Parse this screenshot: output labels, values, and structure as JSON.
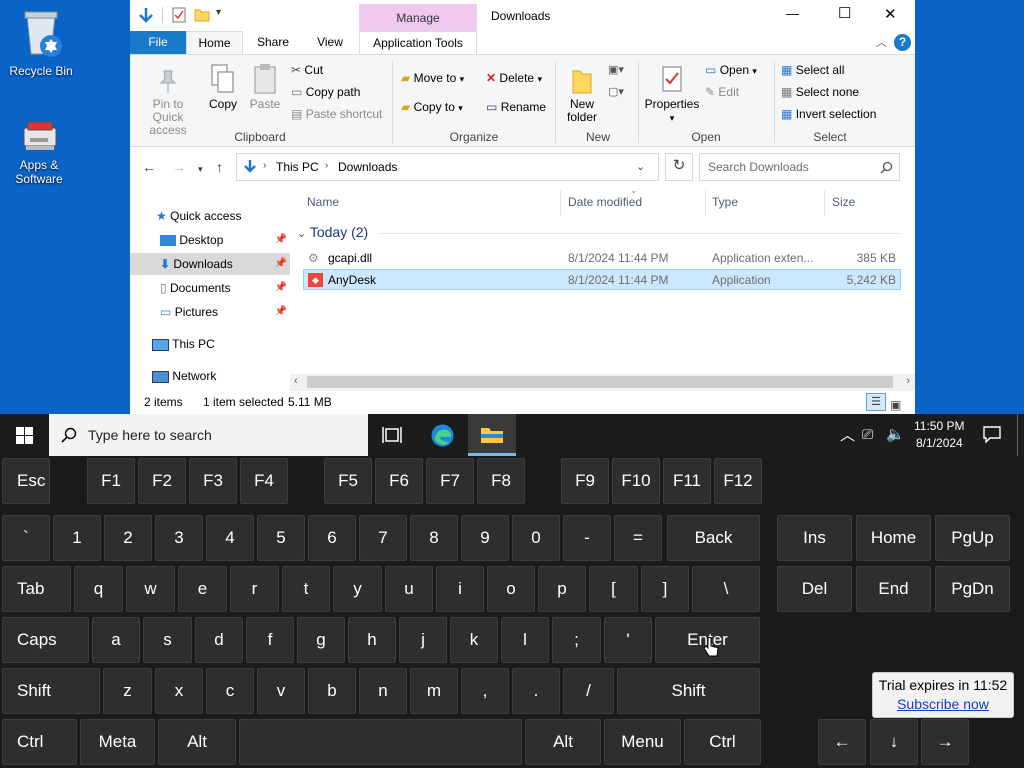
{
  "desktop": {
    "icons": [
      {
        "label": "Recycle Bin"
      },
      {
        "label": "Apps & Software"
      }
    ]
  },
  "explorer": {
    "title": "Downloads",
    "context_tab": "Manage",
    "window_controls": {
      "minimize": "—",
      "maximize": "☐",
      "close": "✕"
    },
    "tabs": [
      "File",
      "Home",
      "Share",
      "View",
      "Application Tools"
    ],
    "ribbon": {
      "clipboard": {
        "pin": "Pin to Quick access",
        "copy": "Copy",
        "paste": "Paste",
        "cut": "Cut",
        "copy_path": "Copy path",
        "paste_shortcut": "Paste shortcut",
        "label": "Clipboard"
      },
      "organize": {
        "move_to": "Move to",
        "copy_to": "Copy to",
        "delete": "Delete",
        "rename": "Rename",
        "label": "Organize"
      },
      "new": {
        "new_folder": "New folder",
        "label": "New"
      },
      "open": {
        "properties": "Properties",
        "open": "Open",
        "edit": "Edit",
        "label": "Open"
      },
      "select": {
        "select_all": "Select all",
        "select_none": "Select none",
        "invert": "Invert selection",
        "label": "Select"
      }
    },
    "address": {
      "crumbs": [
        "This PC",
        "Downloads"
      ],
      "search_placeholder": "Search Downloads"
    },
    "nav": {
      "quick_access": "Quick access",
      "items": [
        "Desktop",
        "Downloads",
        "Documents",
        "Pictures"
      ],
      "this_pc": "This PC",
      "network": "Network"
    },
    "columns": {
      "name": "Name",
      "date": "Date modified",
      "type": "Type",
      "size": "Size"
    },
    "group": "Today (2)",
    "files": [
      {
        "name": "gcapi.dll",
        "date": "8/1/2024 11:44 PM",
        "type": "Application exten...",
        "size": "385 KB"
      },
      {
        "name": "AnyDesk",
        "date": "8/1/2024 11:44 PM",
        "type": "Application",
        "size": "5,242 KB"
      }
    ],
    "status": {
      "items": "2 items",
      "selected": "1 item selected",
      "size": "5.11 MB"
    }
  },
  "taskbar": {
    "search_placeholder": "Type here to search",
    "time": "11:50 PM",
    "date": "8/1/2024"
  },
  "keyboard": {
    "row0": [
      "Esc",
      "F1",
      "F2",
      "F3",
      "F4",
      "F5",
      "F6",
      "F7",
      "F8",
      "F9",
      "F10",
      "F11",
      "F12"
    ],
    "row1": [
      "`",
      "1",
      "2",
      "3",
      "4",
      "5",
      "6",
      "7",
      "8",
      "9",
      "0",
      "-",
      "=",
      "Back",
      "Ins",
      "Home",
      "PgUp"
    ],
    "row2": [
      "Tab",
      "q",
      "w",
      "e",
      "r",
      "t",
      "y",
      "u",
      "i",
      "o",
      "p",
      "[",
      "]",
      "\\",
      "Del",
      "End",
      "PgDn"
    ],
    "row3": [
      "Caps",
      "a",
      "s",
      "d",
      "f",
      "g",
      "h",
      "j",
      "k",
      "l",
      ";",
      "'",
      "Enter"
    ],
    "row4": [
      "Shift",
      "z",
      "x",
      "c",
      "v",
      "b",
      "n",
      "m",
      ",",
      ".",
      "/",
      "Shift",
      "↑"
    ],
    "row5": [
      "Ctrl",
      "Meta",
      "Alt",
      "",
      "Alt",
      "Menu",
      "Ctrl",
      "←",
      "↓",
      "→"
    ]
  },
  "trial": {
    "text": "Trial expires in 11:52",
    "link": "Subscribe now"
  },
  "colors": {
    "accent": "#0a64c8",
    "selection": "#cce8ff",
    "taskbar": "#1c1c1c",
    "keyboard": "#1a1a1a"
  }
}
